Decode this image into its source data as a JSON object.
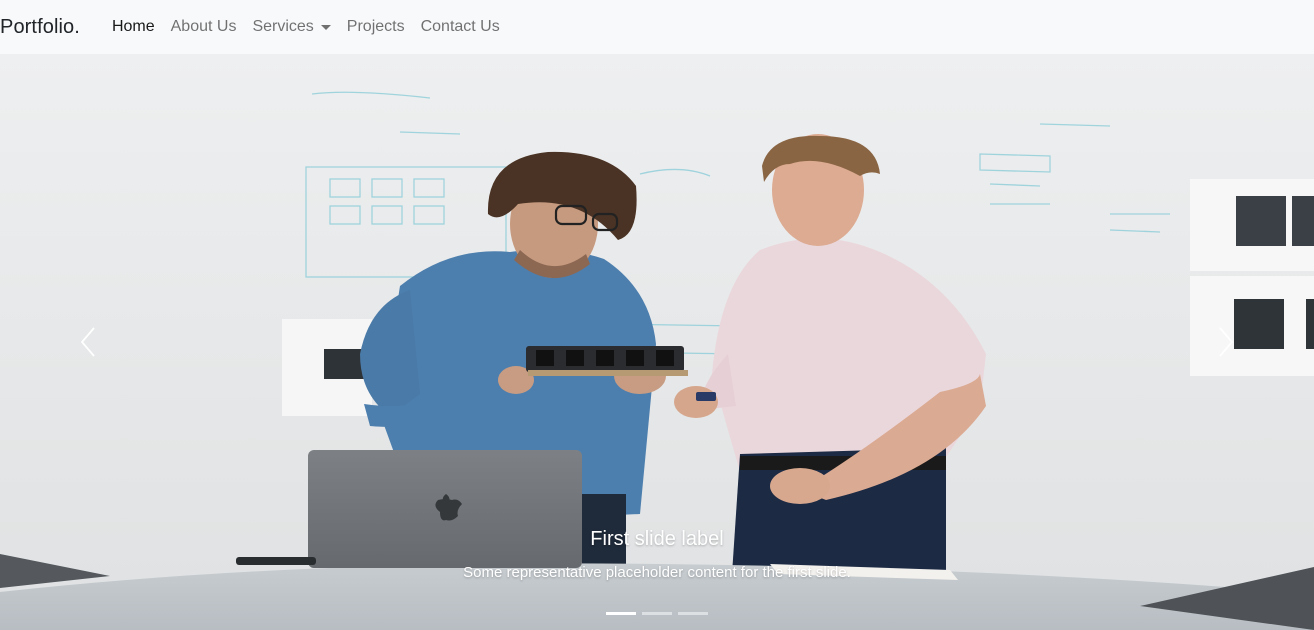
{
  "navbar": {
    "brand": "Portfolio.",
    "links": [
      {
        "label": "Home",
        "active": true
      },
      {
        "label": "About Us",
        "active": false
      },
      {
        "label": "Services",
        "active": false,
        "dropdown": true
      },
      {
        "label": "Projects",
        "active": false
      },
      {
        "label": "Contact Us",
        "active": false
      }
    ]
  },
  "carousel": {
    "slide": {
      "title": "First slide label",
      "text": "Some representative placeholder content for the first slide."
    },
    "indicators": [
      true,
      false,
      false
    ],
    "prev_icon": "chevron-left-icon",
    "next_icon": "chevron-right-icon"
  },
  "colors": {
    "navbar_bg": "#f8f9fa",
    "shirt_blue": "#4d7fae",
    "shirt_pink": "#ead7dc",
    "pants_navy": "#1c2a44"
  }
}
